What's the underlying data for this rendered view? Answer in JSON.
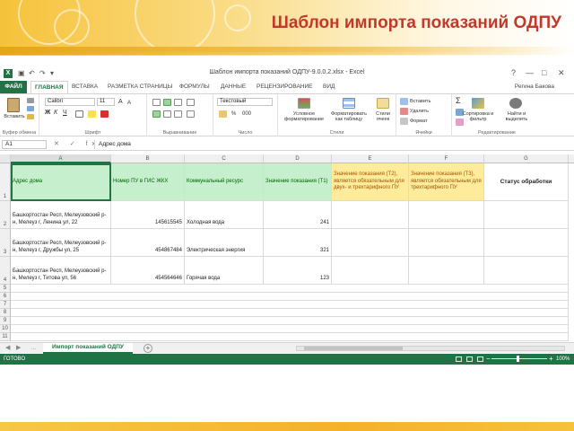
{
  "slide": {
    "title": "Шаблон импорта показаний ОДПУ"
  },
  "window": {
    "title": "Шаблон импорта показаний ОДПУ-9.0.0.2.xlsx - Excel",
    "excel_letter": "X",
    "help": "?",
    "controls": [
      "—",
      "□",
      "✕"
    ]
  },
  "ribbon_tabs": {
    "file": "ФАЙЛ",
    "tabs": [
      "ГЛАВНАЯ",
      "ВСТАВКА",
      "РАЗМЕТКА СТРАНИЦЫ",
      "ФОРМУЛЫ",
      "ДАННЫЕ",
      "РЕЦЕНЗИРОВАНИЕ",
      "ВИД"
    ],
    "active": "ГЛАВНАЯ",
    "user": "Регина Бакова"
  },
  "ribbon": {
    "paste": "Вставить",
    "font_name": "Calibri",
    "font_size": "11",
    "bold": "Ж",
    "italic": "К",
    "underline": "Ч",
    "number_format": "Текстовый",
    "conditional_formatting": "Условное форматирование",
    "format_as_table": "Форматировать как таблицу",
    "cell_styles": "Стили ячеек",
    "insert": "Вставить",
    "delete": "Удалить",
    "format": "Формат",
    "sort_filter": "Сортировка и фильтр",
    "find_select": "Найти и выделить",
    "groups": {
      "clipboard": "Буфер обмена",
      "font": "Шрифт",
      "alignment": "Выравнивание",
      "number": "Число",
      "styles": "Стили",
      "cells": "Ячейки",
      "editing": "Редактирование"
    }
  },
  "formula_bar": {
    "name_box": "A1",
    "fx": "✕ ✓ fx",
    "value": "Адрес дома"
  },
  "sheet": {
    "columns": [
      "A",
      "B",
      "C",
      "D",
      "E",
      "F",
      "G"
    ],
    "header_row": [
      "Адрес дома",
      "Номер ПУ в ГИС ЖКХ",
      "Коммунальный ресурс",
      "Значение показания (Т1)",
      "Значение показания (Т2), является обязательным для двух- и трехтарифного ПУ",
      "Значение показания (Т3), является обязательным для трехтарифного ПУ",
      "Статус обработки"
    ],
    "rows": [
      {
        "num": "2",
        "address": "Башкортостан Респ, Мелеузовский р-н, Мелеуз г, Ленина ул, 22",
        "meter": "145615545",
        "resource": "Холодная вода",
        "t1": "241"
      },
      {
        "num": "3",
        "address": "Башкортостан Респ, Мелеузовский р-н, Мелеуз г, Дружбы ул, 25",
        "meter": "454867484",
        "resource": "Электрическая энергия",
        "t1": "321"
      },
      {
        "num": "4",
        "address": "Башкортостан Респ, Мелеузовский р-н, Мелеуз г, Титова ул, 56",
        "meter": "454564646",
        "resource": "Горячая вода",
        "t1": "123"
      }
    ],
    "empty_rows": [
      "5",
      "6",
      "7",
      "8",
      "9",
      "10",
      "11"
    ],
    "header_row_num": "1",
    "tab": "Импорт показаний ОДПУ",
    "add_sheet": "+"
  },
  "status_bar": {
    "text": "ГОТОВО",
    "zoom_minus": "−",
    "zoom_plus": "+",
    "zoom": "100%"
  },
  "colors": {
    "excel_green": "#217346",
    "header_green": "#c6efce",
    "header_yellow": "#ffeb9c",
    "title_red": "#c0392b"
  }
}
